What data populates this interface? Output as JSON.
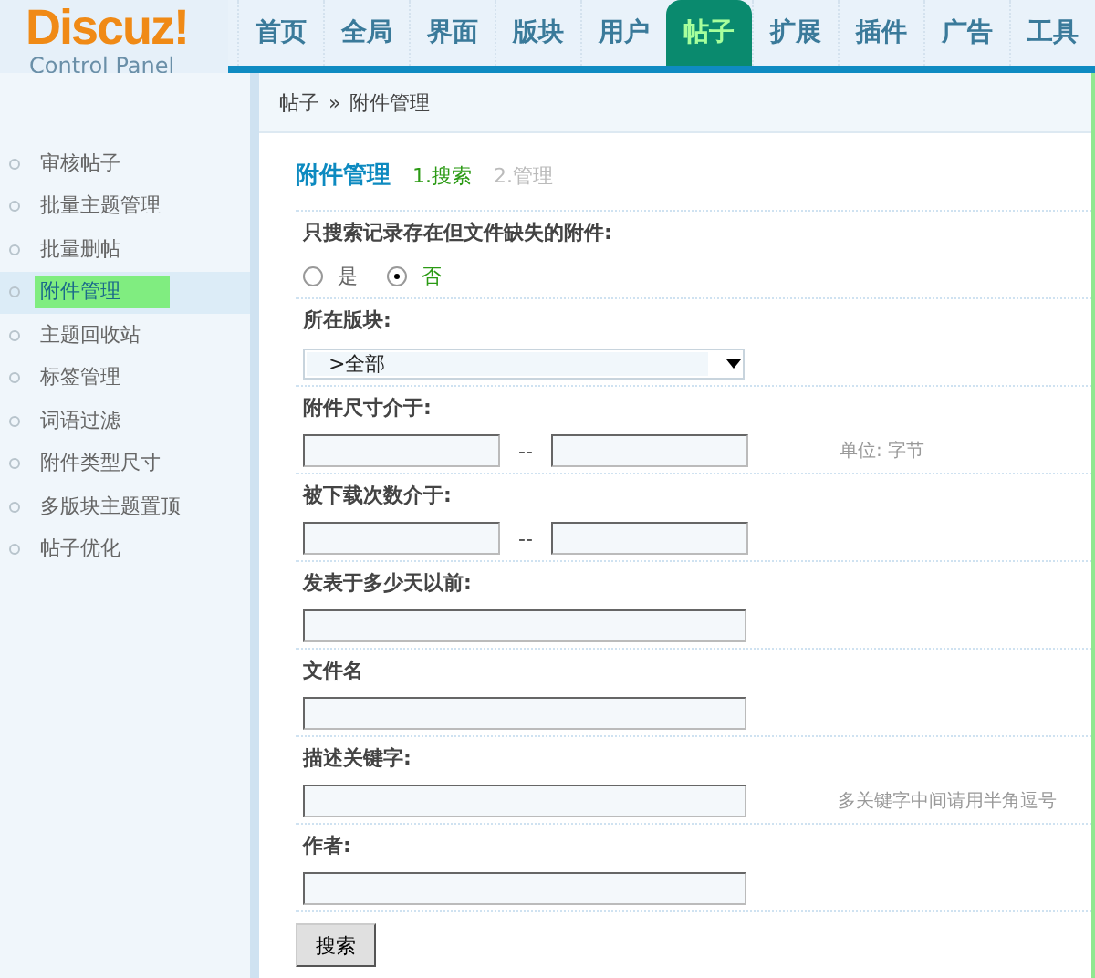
{
  "logo": {
    "title": "Discuz!",
    "subtitle": "Control Panel"
  },
  "nav": [
    {
      "label": "首页",
      "selected": false
    },
    {
      "label": "全局",
      "selected": false
    },
    {
      "label": "界面",
      "selected": false
    },
    {
      "label": "版块",
      "selected": false
    },
    {
      "label": "用户",
      "selected": false
    },
    {
      "label": "帖子",
      "selected": true
    },
    {
      "label": "扩展",
      "selected": false
    },
    {
      "label": "插件",
      "selected": false
    },
    {
      "label": "广告",
      "selected": false
    },
    {
      "label": "工具",
      "selected": false
    }
  ],
  "breadcrumb": {
    "items": [
      "帖子",
      "附件管理"
    ],
    "separator": "»"
  },
  "sidebar": {
    "items": [
      {
        "label": "审核帖子",
        "selected": false
      },
      {
        "label": "批量主题管理",
        "selected": false
      },
      {
        "label": "批量删帖",
        "selected": false
      },
      {
        "label": "附件管理",
        "selected": true
      },
      {
        "label": "主题回收站",
        "selected": false
      },
      {
        "label": "标签管理",
        "selected": false
      },
      {
        "label": "词语过滤",
        "selected": false
      },
      {
        "label": "附件类型尺寸",
        "selected": false
      },
      {
        "label": "多版块主题置顶",
        "selected": false
      },
      {
        "label": "帖子优化",
        "selected": false
      }
    ]
  },
  "page_title": "附件管理",
  "steps": [
    {
      "label": "1.搜索",
      "selected": true
    },
    {
      "label": "2.管理",
      "selected": false
    }
  ],
  "form": [
    {
      "kind": "radio",
      "label": "只搜索记录存在但文件缺失的附件:",
      "options": [
        {
          "label": "是",
          "selected": false
        },
        {
          "label": "否",
          "selected": true
        }
      ]
    },
    {
      "kind": "select",
      "label": "所在版块:",
      "value": ">全部"
    },
    {
      "kind": "range",
      "label": "附件尺寸介于:",
      "separator": "--",
      "hint": "单位: 字节"
    },
    {
      "kind": "range",
      "label": "被下载次数介于:",
      "separator": "--"
    },
    {
      "kind": "text",
      "label": "发表于多少天以前:"
    },
    {
      "kind": "text",
      "label": "文件名"
    },
    {
      "kind": "text",
      "label": "描述关键字:",
      "hint": "多关键字中间请用半角逗号"
    },
    {
      "kind": "text",
      "label": "作者:"
    }
  ],
  "submit": "搜索"
}
